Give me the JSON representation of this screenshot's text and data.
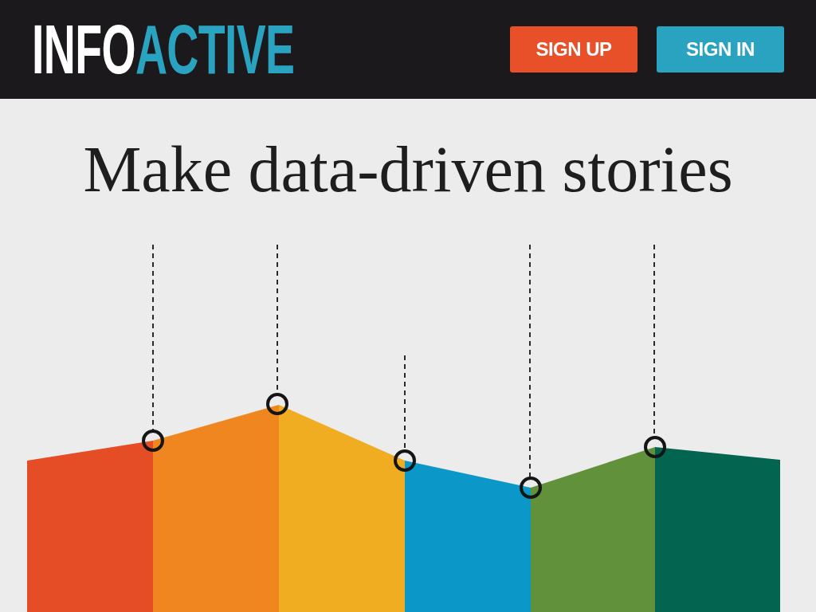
{
  "header": {
    "logo": [
      {
        "text": "INFO",
        "color": "#ffffff"
      },
      {
        "text": "ACTIVE",
        "color": "#2aa3c1"
      }
    ],
    "buttons": [
      {
        "label": "SIGN UP",
        "kind": "primary"
      },
      {
        "label": "SIGN IN",
        "kind": "secondary"
      }
    ]
  },
  "hero": {
    "headline": "Make data-driven stories"
  }
}
